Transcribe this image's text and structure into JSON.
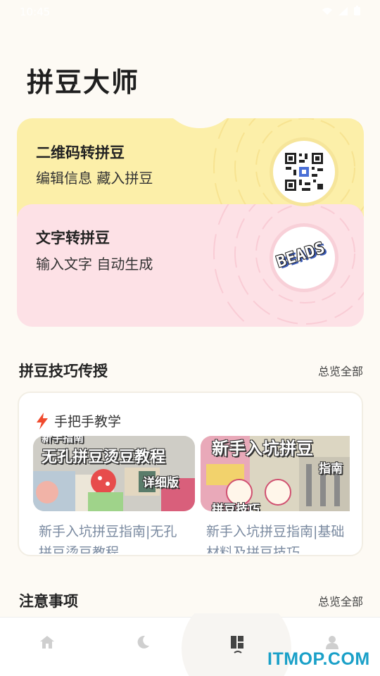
{
  "status_bar": {
    "time": "10:45"
  },
  "app": {
    "title": "拼豆大师"
  },
  "features": [
    {
      "title": "二维码转拼豆",
      "subtitle": "编辑信息 藏入拼豆",
      "icon": "qr-code-icon",
      "bg": "#fcefa9"
    },
    {
      "title": "文字转拼豆",
      "subtitle": "输入文字  自动生成",
      "icon": "beads-logo-icon",
      "logo_text": "BEADS",
      "bg": "#fde1e6"
    }
  ],
  "tips_section": {
    "title": "拼豆技巧传授",
    "see_all": "总览全部",
    "header_label": "手把手教学",
    "header_icon": "lightning-icon",
    "items": [
      {
        "overlay_top": "新手指南",
        "overlay_main": "无孔拼豆烫豆教程",
        "overlay_badge": "详细版",
        "title": "新手入坑拼豆指南|无孔拼豆烫豆教程"
      },
      {
        "overlay_main": "新手入坑拼豆",
        "overlay_badge": "指南",
        "overlay_bottom": "拼豆技巧",
        "title": "新手入坑拼豆指南|基础材料及拼豆技巧"
      }
    ]
  },
  "notes_section": {
    "title": "注意事项",
    "see_all": "总览全部"
  },
  "nav": [
    {
      "name": "home",
      "icon": "home-icon"
    },
    {
      "name": "discover",
      "icon": "moon-icon"
    },
    {
      "name": "works",
      "icon": "grid-icon",
      "active": true
    },
    {
      "name": "profile",
      "icon": "person-icon"
    }
  ],
  "watermark": "ITMOP.COM"
}
